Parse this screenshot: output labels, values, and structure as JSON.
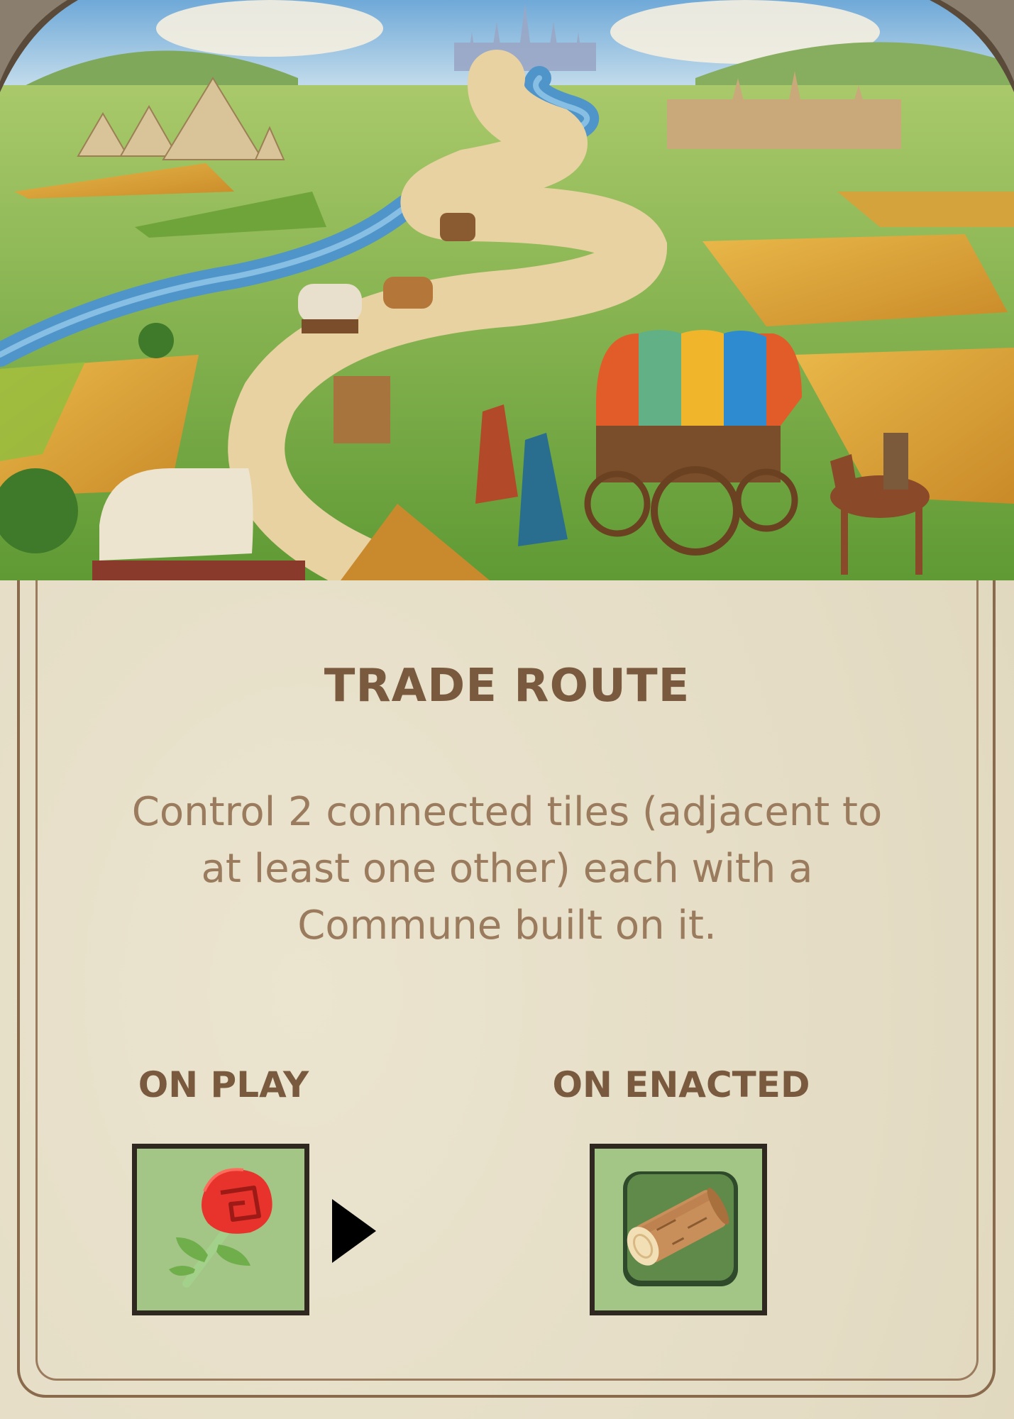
{
  "card": {
    "title": "TRADE ROUTE",
    "rules_text": "Control 2 connected tiles (adjacent to at least one other) each with a Commune built on it.",
    "on_play": {
      "label": "ON PLAY",
      "icon": "rose-icon"
    },
    "on_enacted": {
      "label": "ON ENACTED",
      "icon": "wood-log-icon"
    },
    "transition_icon": "play-arrow-icon"
  },
  "colors": {
    "parchment": "#e4dcc4",
    "title_text": "#7a5a3e",
    "rules_text": "#9a7b5d",
    "tile_fill": "#a3c585",
    "tile_border": "#2f2820"
  }
}
